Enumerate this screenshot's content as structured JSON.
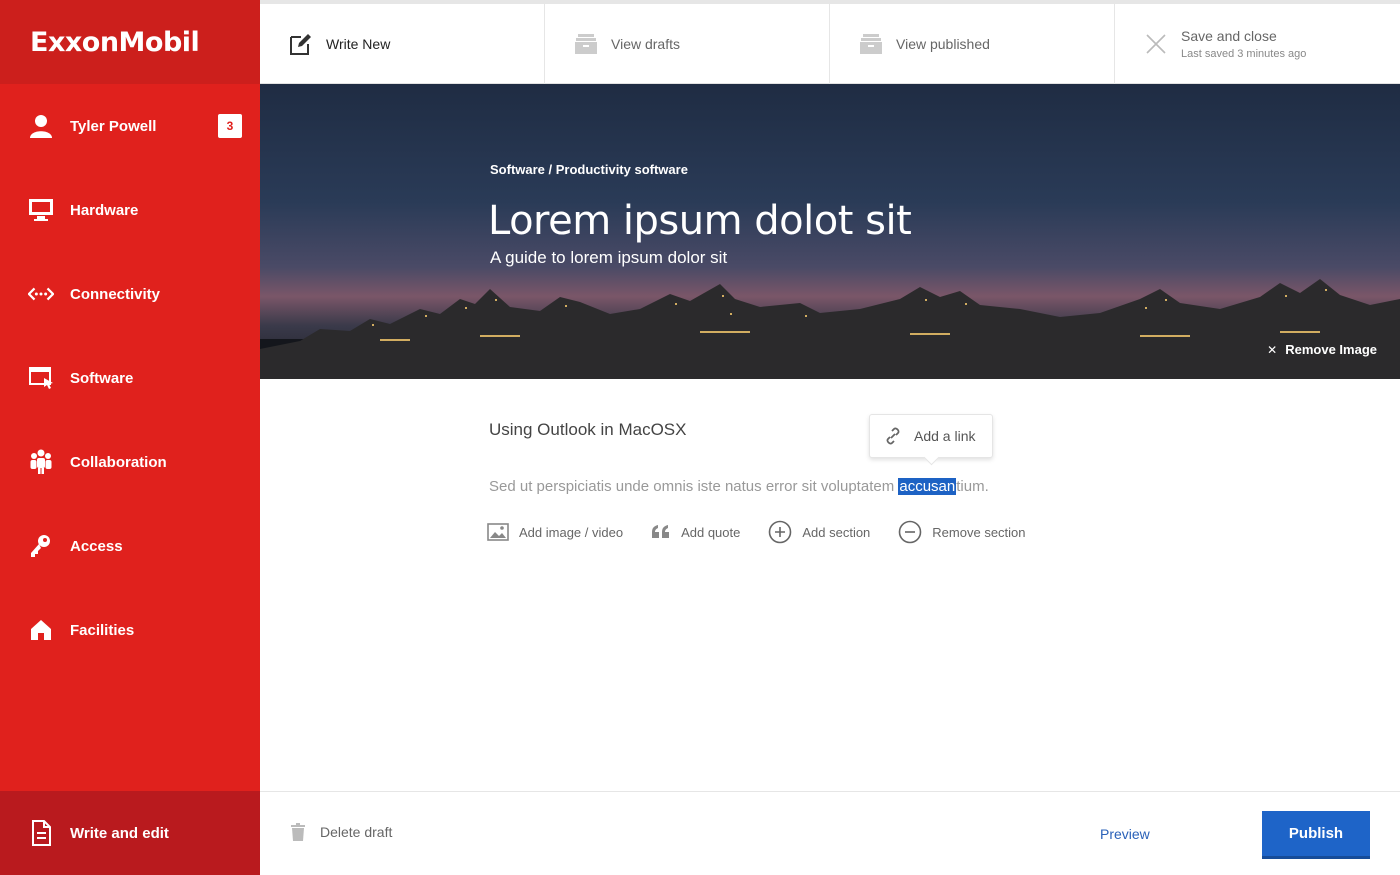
{
  "brand": {
    "logo_text": "ExxonMobil",
    "primary_red": "#e0211d",
    "dark_red": "#b91a1e",
    "publish_blue": "#1e64c8"
  },
  "sidebar": {
    "user": {
      "name": "Tyler Powell",
      "badge_count": "3",
      "icon": "user-icon"
    },
    "items": [
      {
        "label": "Hardware",
        "icon": "monitor-icon"
      },
      {
        "label": "Connectivity",
        "icon": "connectivity-icon"
      },
      {
        "label": "Software",
        "icon": "software-window-icon"
      },
      {
        "label": "Collaboration",
        "icon": "people-icon"
      },
      {
        "label": "Access",
        "icon": "key-icon"
      },
      {
        "label": "Facilities",
        "icon": "home-icon"
      }
    ],
    "bottom": {
      "label": "Write and edit",
      "icon": "document-icon"
    }
  },
  "topbar": {
    "tabs": [
      {
        "label": "Write New",
        "icon": "edit-icon"
      },
      {
        "label": "View drafts",
        "icon": "drafts-tray-icon"
      },
      {
        "label": "View published",
        "icon": "published-tray-icon"
      },
      {
        "label": "Save and close",
        "sub": "Last saved 3 minutes ago",
        "icon": "close-icon"
      }
    ]
  },
  "hero": {
    "breadcrumb": "Software / Productivity software",
    "title": "Lorem ipsum dolot sit",
    "subtitle": "A guide to lorem ipsum dolor sit",
    "remove_image": "Remove Image"
  },
  "editor": {
    "section_title": "Using Outlook in MacOSX",
    "body_before": "Sed ut perspiciatis unde omnis iste natus error sit voluptatem ",
    "body_selected": "accusan",
    "body_after": "tium.",
    "link_popover": "Add a link",
    "actions": [
      {
        "label": "Add image / video",
        "icon": "image-icon"
      },
      {
        "label": "Add quote",
        "icon": "quote-icon"
      },
      {
        "label": "Add section",
        "icon": "plus-circle-icon"
      },
      {
        "label": "Remove section",
        "icon": "minus-circle-icon"
      }
    ]
  },
  "footer": {
    "delete_label": "Delete draft",
    "preview_label": "Preview",
    "publish_label": "Publish"
  }
}
